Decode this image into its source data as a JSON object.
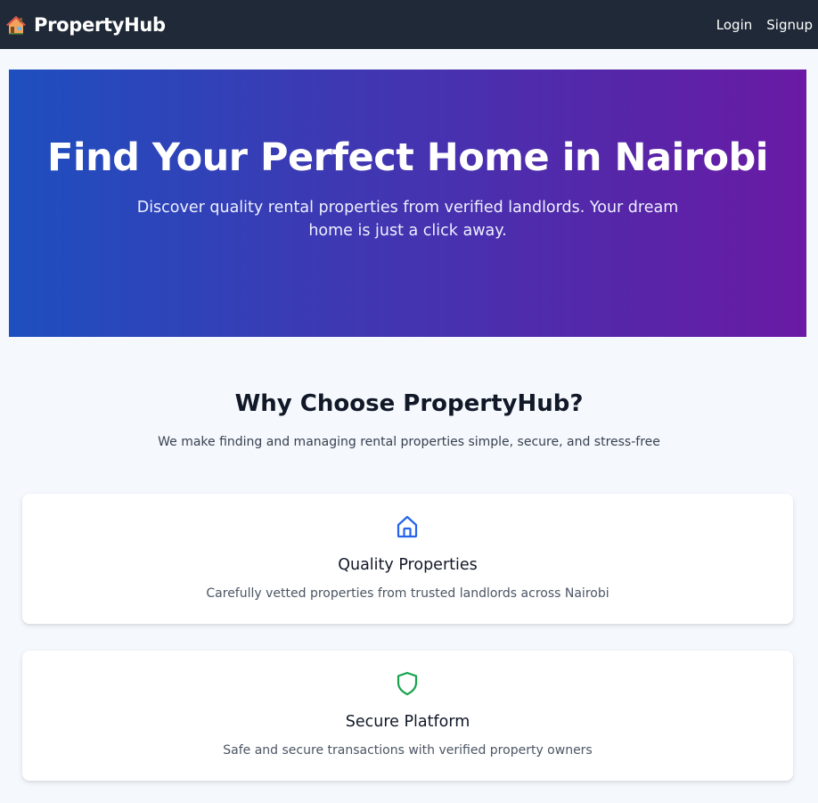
{
  "navbar": {
    "brand_icon": "house-icon",
    "brand_name": "PropertyHub",
    "links": [
      "Login",
      "Signup"
    ]
  },
  "hero": {
    "title": "Find Your Perfect Home in Nairobi",
    "subtitle": "Discover quality rental properties from verified landlords. Your dream home is just a click away."
  },
  "features": {
    "title": "Why Choose PropertyHub?",
    "subtitle": "We make finding and managing rental properties simple, secure, and stress-free",
    "cards": [
      {
        "icon": "home-outline-icon",
        "icon_color": "#2563eb",
        "title": "Quality Properties",
        "text": "Carefully vetted properties from trusted landlords across Nairobi"
      },
      {
        "icon": "shield-icon",
        "icon_color": "#16a34a",
        "title": "Secure Platform",
        "text": "Safe and secure transactions with verified property owners"
      }
    ]
  },
  "colors": {
    "navbar_bg": "#1f2937",
    "hero_gradient_start": "#1e4fbf",
    "hero_gradient_end": "#6a1aa5",
    "page_bg": "#f5f8fc"
  }
}
